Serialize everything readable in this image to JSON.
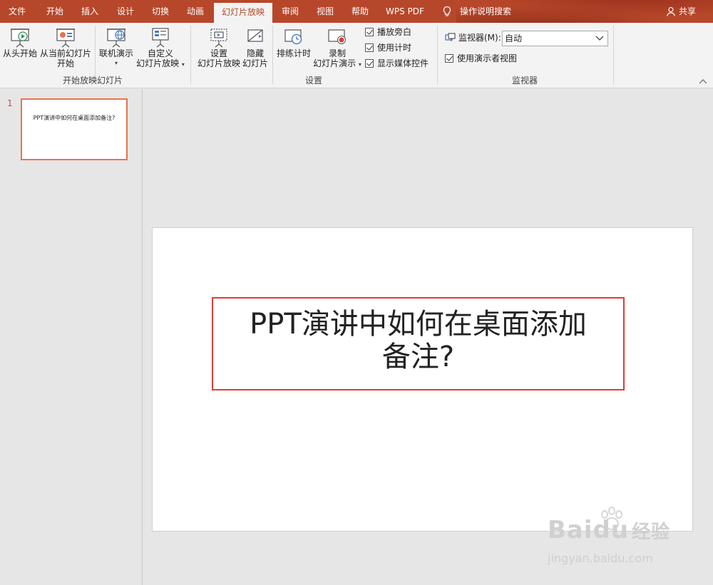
{
  "menu": {
    "tabs": [
      {
        "label": "文件"
      },
      {
        "label": "开始"
      },
      {
        "label": "插入"
      },
      {
        "label": "设计"
      },
      {
        "label": "切换"
      },
      {
        "label": "动画"
      },
      {
        "label": "幻灯片放映",
        "active": true
      },
      {
        "label": "审阅"
      },
      {
        "label": "视图"
      },
      {
        "label": "帮助"
      },
      {
        "label": "WPS PDF"
      }
    ],
    "tell_me": "操作说明搜索",
    "share": "共享"
  },
  "ribbon": {
    "start_group": {
      "label": "开始放映幻灯片",
      "from_beginning": "从头开始",
      "from_current_line1": "从当前幻灯片",
      "from_current_line2": "开始",
      "online_present": "联机演示",
      "custom_line1": "自定义",
      "custom_line2": "幻灯片放映"
    },
    "setup_group": {
      "label": "设置",
      "setup_line1": "设置",
      "setup_line2": "幻灯片放映",
      "hide_line1": "隐藏",
      "hide_line2": "幻灯片",
      "rehearse": "排练计时",
      "record_line1": "录制",
      "record_line2": "幻灯片演示",
      "play_narrations": "播放旁白",
      "use_timings": "使用计时",
      "show_media_controls": "显示媒体控件"
    },
    "monitor_group": {
      "label": "监视器",
      "monitor_label": "监视器(M):",
      "monitor_value": "自动",
      "presenter_view": "使用演示者视图"
    }
  },
  "thumbnails": [
    {
      "number": "1",
      "title": "PPT演讲中如何在桌面添加备注?"
    }
  ],
  "slide": {
    "title_line1": "PPT演讲中如何在桌面添加",
    "title_line2": "备注?"
  },
  "watermark": {
    "brand": "Baidu",
    "brand_cn": "经验",
    "url": "jingyan.baidu.com"
  }
}
